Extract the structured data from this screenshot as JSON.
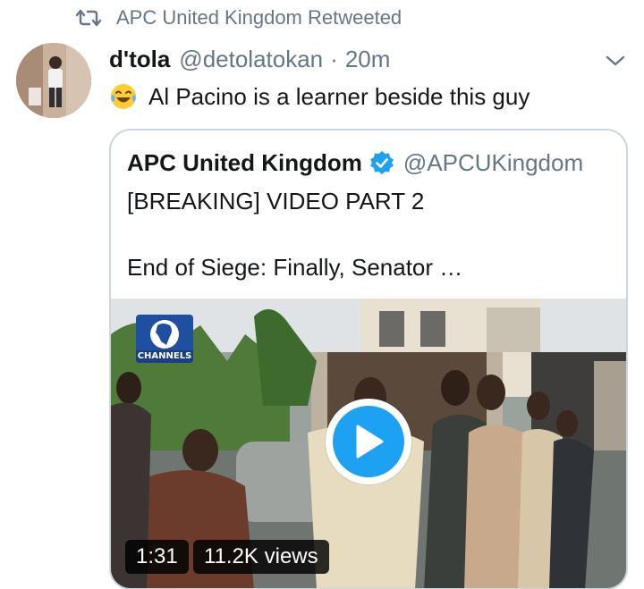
{
  "retweet_banner": {
    "icon": "retweet-icon",
    "text": "APC United Kingdom Retweeted"
  },
  "tweet": {
    "author_name": "d'tola",
    "author_handle": "@detolatokan",
    "separator": "·",
    "time": "20m",
    "emoji": "face-with-tears-of-joy",
    "text": "Al Pacino is a learner beside this guy"
  },
  "quoted_tweet": {
    "author_name": "APC United Kingdom",
    "verified": true,
    "author_handle": "@APCUKingdom",
    "line1": "[BREAKING] VIDEO PART 2",
    "line2": "End of Siege:  Finally, Senator …",
    "media": {
      "type": "video",
      "channel_logo_text": "CHANNELS",
      "duration": "1:31",
      "views": "11.2K views"
    }
  },
  "colors": {
    "accent": "#1da1f2",
    "secondary_text": "#657786",
    "border": "#ccd6dd"
  }
}
